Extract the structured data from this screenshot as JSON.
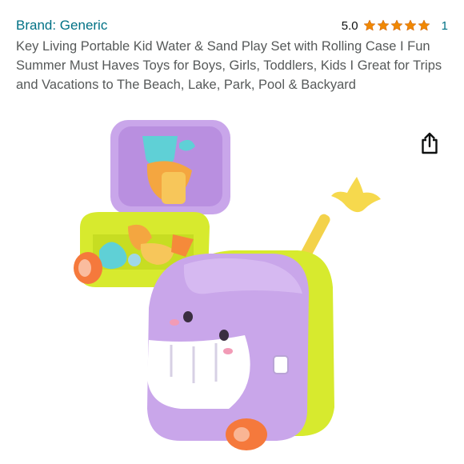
{
  "product": {
    "brand_link": "Brand: Generic",
    "rating_value": "5.0",
    "rating_stars": 5,
    "rating_count": "1",
    "title": "Key Living Portable Kid Water & Sand Play Set with Rolling Case I Fun Summer Must Haves Toys for Boys, Girls, Toddlers, Kids I Great for Trips and Vacations to The Beach, Lake, Park, Pool & Backyard"
  },
  "icons": {
    "share": "share-icon",
    "star": "star-icon"
  },
  "colors": {
    "link": "#007185",
    "star": "#f08804",
    "title": "#565959",
    "case_lilac": "#c9a6ea",
    "case_lime": "#d7ea2e",
    "wheel_orange": "#f5793c"
  }
}
